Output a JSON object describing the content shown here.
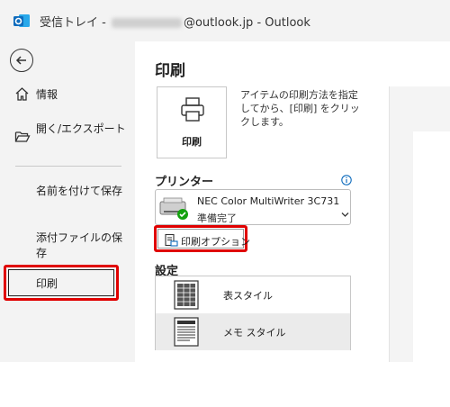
{
  "window": {
    "title_prefix": "受信トレイ - ",
    "title_email_visible": "@outlook.jp",
    "title_suffix": " -  Outlook"
  },
  "sidebar": {
    "items": [
      {
        "label": "情報",
        "icon": "home-icon"
      },
      {
        "label": "開く/エクスポート",
        "icon": "folder-open-icon"
      },
      {
        "label": "名前を付けて保存"
      },
      {
        "label": "添付ファイルの保存"
      },
      {
        "label": "印刷"
      }
    ]
  },
  "main": {
    "title": "印刷",
    "print_button_label": "印刷",
    "description": "アイテムの印刷方法を指定してから、[印刷] をクリックします。",
    "printer_heading": "プリンター",
    "printer": {
      "name": "NEC Color MultiWriter 3C731",
      "status": "準備完了"
    },
    "print_options_label": "印刷オプション",
    "settings_heading": "設定",
    "styles": [
      {
        "label": "表スタイル",
        "selected": false
      },
      {
        "label": "メモ スタイル",
        "selected": true
      }
    ]
  },
  "colors": {
    "highlight": "#e00000",
    "outlook_blue": "#0f6cbd",
    "status_green": "#13a10e"
  }
}
